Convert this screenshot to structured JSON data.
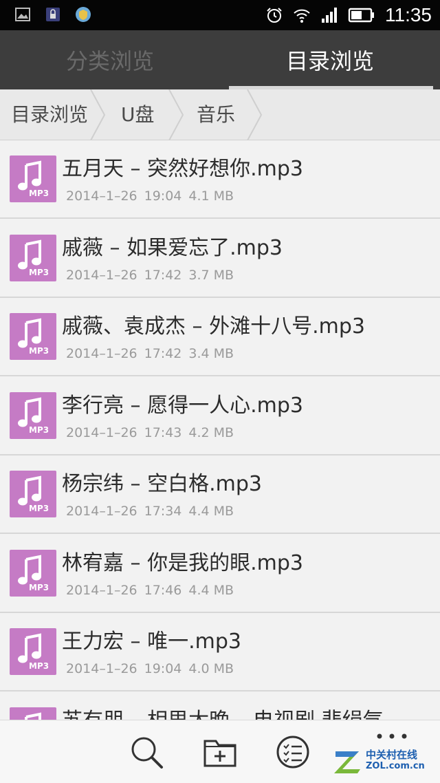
{
  "status_bar": {
    "time": "11:35",
    "left_icons": [
      "image-icon",
      "lock-app-icon",
      "shield-app-icon"
    ],
    "right_icons": [
      "alarm-icon",
      "wifi-icon",
      "signal-icon",
      "battery-icon"
    ]
  },
  "tabs": [
    {
      "label": "分类浏览",
      "active": false
    },
    {
      "label": "目录浏览",
      "active": true
    }
  ],
  "breadcrumb": [
    "目录浏览",
    "U盘",
    "音乐"
  ],
  "files": [
    {
      "name": "五月天 – 突然好想你.mp3",
      "date": "2014–1–26",
      "time": "19:04",
      "size": "4.1 MB"
    },
    {
      "name": "戚薇 – 如果爱忘了.mp3",
      "date": "2014–1–26",
      "time": "17:42",
      "size": "3.7 MB"
    },
    {
      "name": "戚薇、袁成杰 – 外滩十八号.mp3",
      "date": "2014–1–26",
      "time": "17:42",
      "size": "3.4 MB"
    },
    {
      "name": "李行亮 – 愿得一人心.mp3",
      "date": "2014–1–26",
      "time": "17:43",
      "size": "4.2 MB"
    },
    {
      "name": "杨宗纬 – 空白格.mp3",
      "date": "2014–1–26",
      "time": "17:34",
      "size": "4.4 MB"
    },
    {
      "name": "林宥嘉 – 你是我的眼.mp3",
      "date": "2014–1–26",
      "time": "17:46",
      "size": "4.4 MB"
    },
    {
      "name": "王力宏 – 唯一.mp3",
      "date": "2014–1–26",
      "time": "19:04",
      "size": "4.0 MB"
    },
    {
      "name": "苏有朋 – 相思太晚 – 电视剧 悲绢气",
      "date": "",
      "time": "",
      "size": ""
    }
  ],
  "file_icon_label": "MP3",
  "toolbar": {
    "buttons": [
      "search-icon",
      "new-folder-icon",
      "multi-select-icon",
      "more-icon"
    ]
  },
  "watermark": {
    "line1": "中关村在线",
    "line2": "ZOL.com.cn"
  },
  "colors": {
    "tab_bar": "#3d3d3d",
    "file_icon": "#c57bc5",
    "status_bar": "#050505"
  }
}
